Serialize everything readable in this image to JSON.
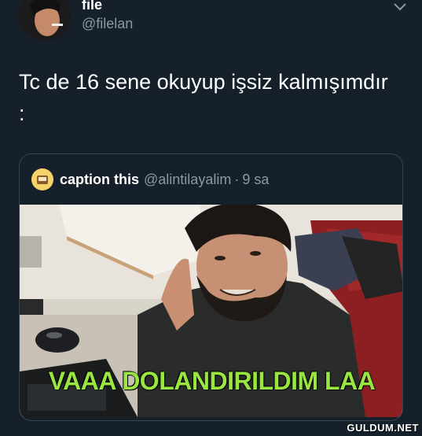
{
  "author": {
    "name": "file",
    "handle": "@filelan"
  },
  "tweet": {
    "text": "Tc de 16 sene okuyup işsiz kalmışımdır :"
  },
  "quoted": {
    "name": "caption this",
    "handle": "@alintilayalim",
    "separator": "·",
    "time": "9 sa",
    "caption": "VAAA DOLANDIRILDIM LAA"
  },
  "watermark": "GULDUM.NET",
  "colors": {
    "background": "#15202b",
    "secondary_text": "#8899a6",
    "caption": "#9ae640"
  }
}
